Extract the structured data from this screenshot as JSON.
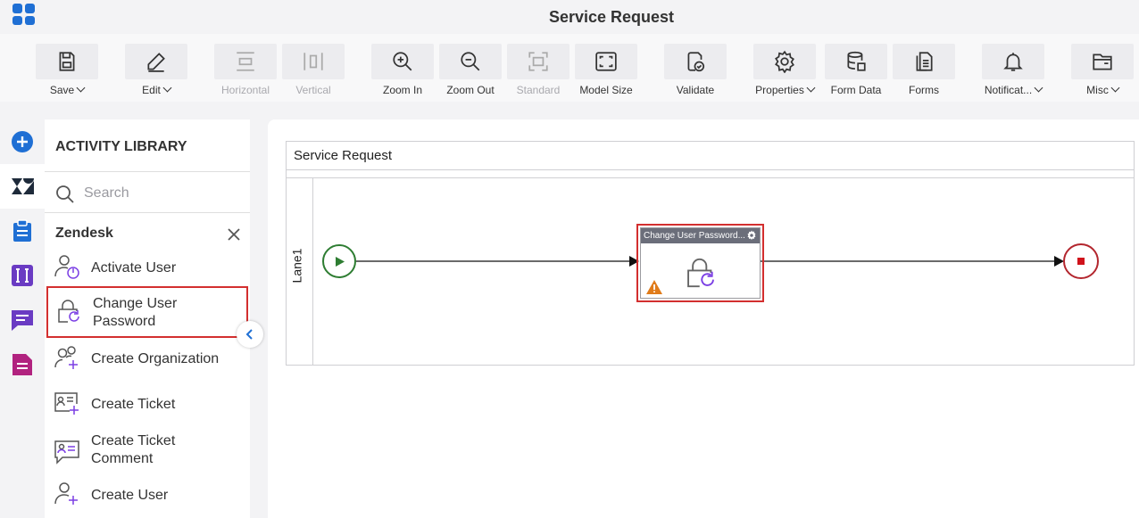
{
  "app": {
    "title": "Service Request",
    "apps_icon": "grid-apps-icon"
  },
  "toolbar": {
    "save": "Save",
    "edit": "Edit",
    "horizontal": "Horizontal",
    "vertical": "Vertical",
    "zoom_in": "Zoom In",
    "zoom_out": "Zoom Out",
    "standard": "Standard",
    "model_size": "Model Size",
    "validate": "Validate",
    "properties": "Properties",
    "form_data": "Form Data",
    "forms": "Forms",
    "notifications": "Notificat...",
    "misc": "Misc"
  },
  "rail": {
    "items": [
      "add-icon",
      "zendesk-icon",
      "clipboard-icon",
      "text-icon",
      "chat-icon",
      "document-icon"
    ]
  },
  "library": {
    "title": "ACTIVITY LIBRARY",
    "search_placeholder": "Search",
    "group": "Zendesk",
    "items": [
      {
        "label": "Activate User",
        "icon": "user-power-icon"
      },
      {
        "label": "Change User Password",
        "icon": "lock-refresh-icon"
      },
      {
        "label": "Create Organization",
        "icon": "users-add-icon"
      },
      {
        "label": "Create Ticket",
        "icon": "ticket-add-icon"
      },
      {
        "label": "Create Ticket Comment",
        "icon": "ticket-comment-icon"
      },
      {
        "label": "Create User",
        "icon": "user-add-icon"
      }
    ]
  },
  "canvas": {
    "pool_title": "Service Request",
    "lane_label": "Lane1",
    "task_title": "Change User Password...",
    "colors": {
      "start": "#2e7d32",
      "end": "#d0121b",
      "highlight": "#d32f2f",
      "accent": "#1f6fd4"
    }
  }
}
